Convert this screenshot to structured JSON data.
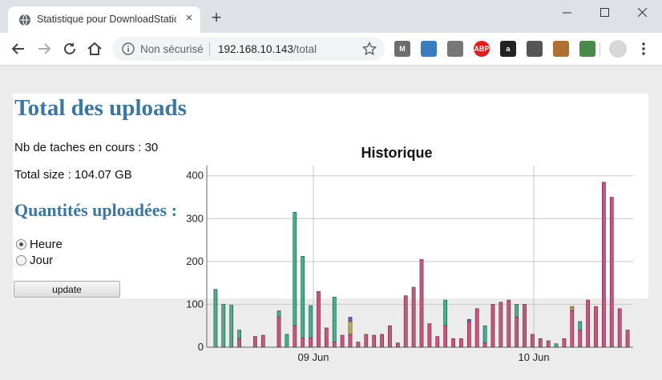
{
  "browser": {
    "tab_title": "Statistique pour DownloadStation",
    "tab_close": "×",
    "new_tab": "+",
    "security_label": "Non sécurisé",
    "url_host": "192.168.10.143",
    "url_path": "/total",
    "extensions": [
      {
        "name": "gmail-icon",
        "color": "#6d6d6d",
        "text": "M"
      },
      {
        "name": "photo-extension-icon",
        "color": "#3b7bbf",
        "text": ""
      },
      {
        "name": "chat-extension-icon",
        "color": "#777777",
        "text": ""
      },
      {
        "name": "adblock-icon",
        "color": "#e01e1e",
        "text": "ABP"
      },
      {
        "name": "amazon-icon",
        "color": "#222222",
        "text": "a"
      },
      {
        "name": "bulb-extension-icon",
        "color": "#555555",
        "text": ""
      },
      {
        "name": "edit-extension-icon",
        "color": "#b07030",
        "text": ""
      },
      {
        "name": "reader-extension-icon",
        "color": "#4a8a4a",
        "text": ""
      }
    ]
  },
  "page": {
    "title": "Total des uploads",
    "running_tasks": "Nb de taches en cours : 30",
    "total_size": "Total size : 104.07 GB",
    "subtitle": "Quantités uploadées :",
    "radio_options": [
      {
        "label": "Heure",
        "checked": true
      },
      {
        "label": "Jour",
        "checked": false
      }
    ],
    "update_label": "update"
  },
  "chart_data": {
    "type": "bar",
    "title": "Historique",
    "xlabel": "",
    "ylabel": "",
    "ylim": [
      0,
      420
    ],
    "yticks": [
      0,
      100,
      200,
      300,
      400
    ],
    "xticks": [
      "09 Jun",
      "10 Jun"
    ],
    "grid": true,
    "legend": "none",
    "stacked": true,
    "series": [
      {
        "color": "#d2517e",
        "values": [
          0,
          0,
          0,
          20,
          0,
          25,
          28,
          0,
          70,
          0,
          50,
          22,
          22,
          130,
          45,
          12,
          28,
          30,
          12,
          30,
          28,
          30,
          50,
          10,
          120,
          140,
          205,
          55,
          25,
          50,
          20,
          20,
          60,
          90,
          10,
          100,
          105,
          110,
          70,
          100,
          30,
          20,
          15,
          0,
          20,
          85,
          40,
          110,
          95,
          385,
          350,
          90,
          40
        ]
      },
      {
        "color": "#3fb28e",
        "values": [
          135,
          100,
          98,
          20,
          0,
          0,
          0,
          0,
          15,
          30,
          265,
          190,
          75,
          0,
          0,
          105,
          0,
          0,
          0,
          0,
          0,
          0,
          0,
          0,
          0,
          0,
          0,
          0,
          0,
          60,
          0,
          0,
          0,
          0,
          40,
          0,
          0,
          0,
          30,
          0,
          0,
          0,
          0,
          8,
          0,
          0,
          20,
          0,
          0,
          0,
          0,
          0,
          0
        ]
      },
      {
        "color": "#c7b04a",
        "values": [
          0,
          0,
          0,
          0,
          0,
          0,
          0,
          0,
          0,
          0,
          0,
          0,
          0,
          0,
          0,
          0,
          0,
          30,
          0,
          0,
          0,
          0,
          0,
          0,
          0,
          0,
          0,
          0,
          0,
          0,
          0,
          0,
          0,
          0,
          0,
          0,
          0,
          0,
          0,
          0,
          0,
          0,
          0,
          0,
          0,
          0,
          0,
          0,
          0,
          0,
          0,
          0,
          0
        ]
      },
      {
        "color": "#6a5acd",
        "values": [
          0,
          0,
          0,
          0,
          0,
          0,
          0,
          0,
          0,
          0,
          0,
          0,
          0,
          0,
          0,
          0,
          0,
          10,
          0,
          0,
          0,
          0,
          0,
          0,
          0,
          0,
          0,
          0,
          0,
          0,
          0,
          0,
          5,
          0,
          0,
          0,
          0,
          0,
          0,
          0,
          0,
          0,
          0,
          0,
          0,
          0,
          0,
          0,
          0,
          0,
          0,
          0,
          0
        ]
      },
      {
        "color": "#c98a52",
        "values": [
          0,
          0,
          0,
          0,
          0,
          0,
          0,
          0,
          0,
          0,
          0,
          0,
          0,
          0,
          0,
          0,
          0,
          0,
          0,
          0,
          0,
          0,
          0,
          0,
          0,
          0,
          0,
          0,
          0,
          0,
          0,
          0,
          0,
          0,
          0,
          0,
          0,
          0,
          0,
          0,
          0,
          0,
          0,
          0,
          0,
          10,
          0,
          0,
          0,
          0,
          0,
          0,
          0
        ]
      }
    ]
  }
}
